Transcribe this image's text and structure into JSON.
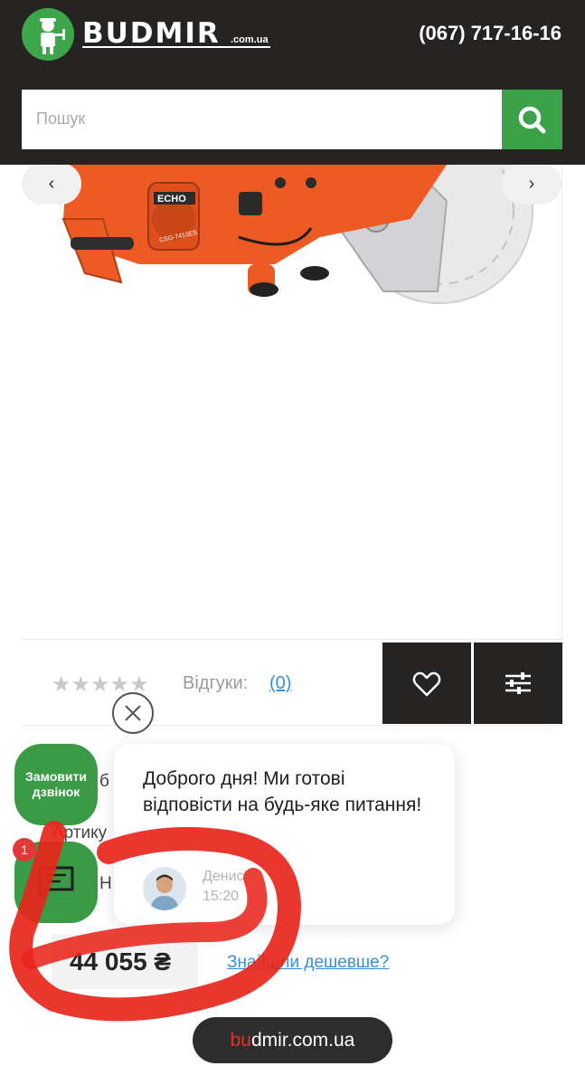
{
  "header": {
    "logo_text": "BUDMIR",
    "logo_domain": ".com.ua",
    "phone": "(067) 717-16-16"
  },
  "search": {
    "placeholder": "Пошук"
  },
  "gallery": {
    "prev_label": "‹",
    "next_label": "›",
    "product_brand": "ECHO",
    "product_model": "CSG-7410ES"
  },
  "rating": {
    "stars": "★★★★★",
    "reviews_label": "Відгуки:",
    "reviews_count": "(0)"
  },
  "info": {
    "line1": "б",
    "line1_prefix": "Вироб",
    "line2": "Артику",
    "line3": "Н"
  },
  "chat": {
    "message": "Доброго дня! Ми готові відповісти на будь-яке питання!",
    "agent_name": "Денис",
    "agent_time": "15:20",
    "callback_label": "Замовити дзвінок",
    "badge": "1"
  },
  "price": {
    "value": "44 055 ₴",
    "cheaper_link": "Знайшли дешевше?"
  },
  "url_pill": {
    "accent": "bu",
    "rest": "dmir.com.ua"
  },
  "colors": {
    "header_bg": "#262323",
    "brand_green": "#3ba24a",
    "link_blue": "#3a8fd6",
    "scribble_red": "#e8261b",
    "product_orange": "#ee5a24"
  }
}
